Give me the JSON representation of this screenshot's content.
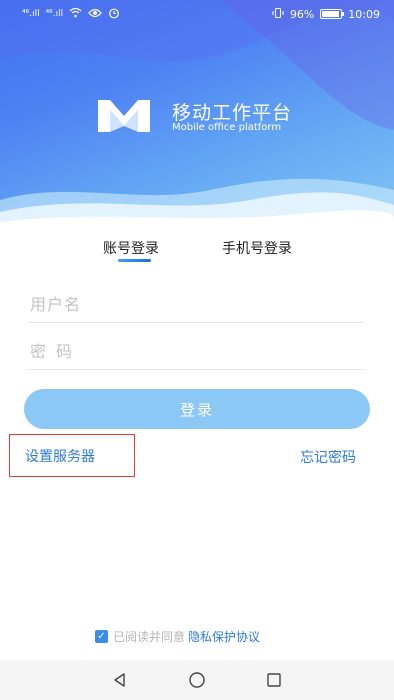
{
  "status_bar": {
    "signal1": "⁴⁶.ıll",
    "signal2": "⁴⁶.ıll",
    "battery_percent": "96%",
    "time": "10:09"
  },
  "brand": {
    "title": "移动工作平台",
    "subtitle": "Mobile office platform"
  },
  "tabs": [
    {
      "label": "账号登录",
      "active": true
    },
    {
      "label": "手机号登录",
      "active": false
    }
  ],
  "form": {
    "username_placeholder": "用户名",
    "password_placeholder": "密码",
    "login_label": "登录"
  },
  "links": {
    "server_settings": "设置服务器",
    "forgot_password": "忘记密码"
  },
  "agreement": {
    "checked": true,
    "text": "已阅读并同意",
    "link": "隐私保护协议"
  },
  "colors": {
    "accent": "#2c7ad8",
    "login_button": "#8cc8f5",
    "highlight_border": "#e33a3a"
  }
}
